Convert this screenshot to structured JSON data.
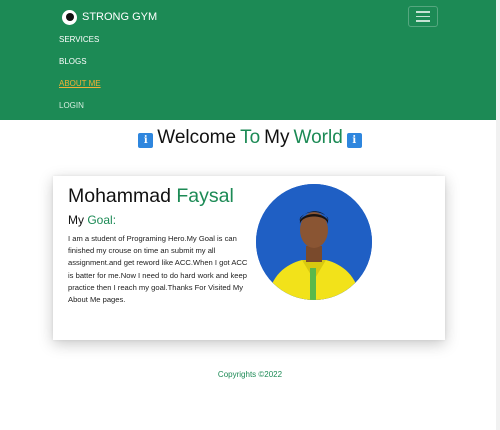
{
  "colors": {
    "nav_bg": "#1c8a55",
    "accent_green": "#1c8a55",
    "active_link": "#f2b035"
  },
  "nav": {
    "brand_icon": "gym-logo-icon",
    "brand": "STRONG GYM",
    "toggler_icon": "hamburger-menu-icon",
    "items": [
      {
        "label": "SERVICES",
        "state": "normal"
      },
      {
        "label": "BLOGS",
        "state": "normal"
      },
      {
        "label": "ABOUT ME",
        "state": "active"
      },
      {
        "label": "LOGIN",
        "state": "muted"
      }
    ]
  },
  "welcome": {
    "icon": "info-icon",
    "part1": "Welcome",
    "part2": "To",
    "part3": "My",
    "part4": "World"
  },
  "profile": {
    "first_name": "Mohammad",
    "last_name": "Faysal",
    "goal_label_1": "My",
    "goal_label_2": "Goal:",
    "goal_text": "I am a student of Programing Hero.My Goal is can finished my crouse on time an submit my all assignment.and get reword like ACC.When I got ACC is batter for me.Now I need to do hard work and keep practice then I reach my goal.Thanks For Visited My About Me pages.",
    "avatar_icon": "profile-photo"
  },
  "footer": {
    "copyright": "Copyrights ©2022"
  }
}
